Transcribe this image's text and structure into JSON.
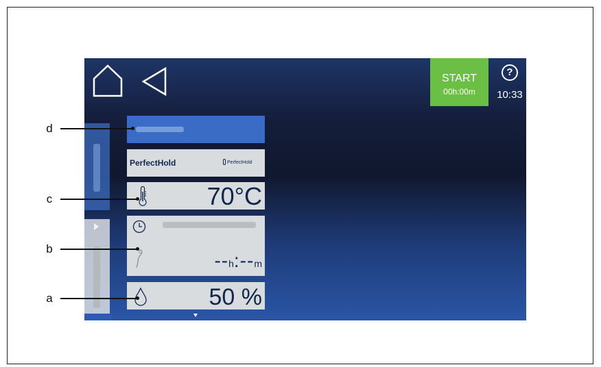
{
  "header": {
    "start_label": "START",
    "start_time": "00h:00m",
    "help_symbol": "?",
    "clock": "10:33"
  },
  "panels": {
    "perfecthold_title": "PerfectHold",
    "perfecthold_logo_text": "PerfectHold",
    "temperature": "70°C",
    "timer_hours": "--",
    "timer_h_unit": "h",
    "timer_sep": ":",
    "timer_minutes": "--",
    "timer_m_unit": "m",
    "humidity": "50 %"
  },
  "callouts": {
    "d": "d",
    "c": "c",
    "b": "b",
    "a": "a"
  },
  "colors": {
    "start_button": "#6cbf45",
    "program_bar": "#3a6cc6",
    "panel_bg": "#d9dcdf",
    "text_dark": "#12274e"
  },
  "icons": [
    "home-icon",
    "back-icon",
    "help-icon",
    "thermometer-icon",
    "clock-icon",
    "probe-icon",
    "drop-icon"
  ]
}
